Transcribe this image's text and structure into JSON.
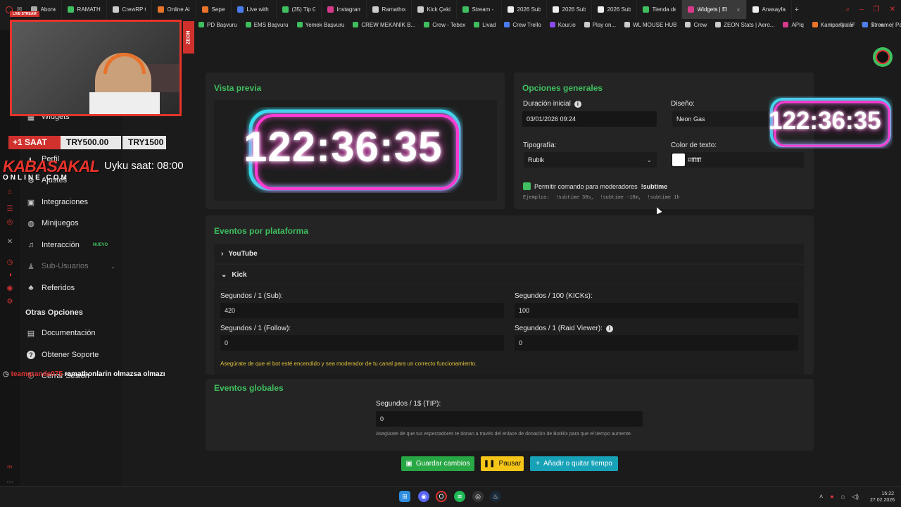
{
  "browser": {
    "tabs": [
      {
        "label": "Abonelikler",
        "color": "#aaaaaa"
      },
      {
        "label": "RAMATHON",
        "color": "#3fbf5f"
      },
      {
        "label": "CrewRP Ca",
        "color": "#cccccc"
      },
      {
        "label": "Online Alışv",
        "color": "#e8732a"
      },
      {
        "label": "Sepetim",
        "color": "#e8732a"
      },
      {
        "label": "Live with Ri",
        "color": "#4a7cf0"
      },
      {
        "label": "(35) Tip Go",
        "color": "#3fbf5f"
      },
      {
        "label": "Instagram",
        "color": "#d63a8a"
      },
      {
        "label": "Ramathon 2",
        "color": "#cccccc"
      },
      {
        "label": "Kick Çekiliş",
        "color": "#cccccc"
      },
      {
        "label": "Stream - Ki",
        "color": "#3fbf5f"
      },
      {
        "label": "2026 Subat",
        "color": "#eeeeee"
      },
      {
        "label": "2026 Subat",
        "color": "#eeeeee"
      },
      {
        "label": "2026 Subat",
        "color": "#eeeeee"
      },
      {
        "label": "Tienda de ...",
        "color": "#3fbf5f"
      },
      {
        "label": "Widgets | El mejor so",
        "color": "#d63a8a",
        "active": true
      },
      {
        "label": "Anasayfa / ...",
        "color": "#eeeeee"
      }
    ],
    "bookmarks": [
      {
        "label": "PD Başvuru",
        "color": "#3fbf5f"
      },
      {
        "label": "EMS Başvuru",
        "color": "#3fbf5f"
      },
      {
        "label": "Yemek Başvuru",
        "color": "#3fbf5f"
      },
      {
        "label": "CREW MEKANİK B...",
        "color": "#3fbf5f"
      },
      {
        "label": "Crew - Tebex",
        "color": "#3fbf5f"
      },
      {
        "label": "Livad",
        "color": "#3fbf5f"
      },
      {
        "label": "Crew Trello",
        "color": "#4a7cf0"
      },
      {
        "label": "Kour.io",
        "color": "#8a4af0"
      },
      {
        "label": "Play on...",
        "color": "#cccccc"
      },
      {
        "label": "WL MOUSE HUB",
        "color": "#cccccc"
      },
      {
        "label": "Crew",
        "color": "#cccccc"
      },
      {
        "label": "ZEON Stats | Aero...",
        "color": "#cccccc"
      },
      {
        "label": "APIq",
        "color": "#d63a8a"
      },
      {
        "label": "Kampanyalar",
        "color": "#e8732a"
      },
      {
        "label": "Streamer Panel",
        "color": "#4a7cf0"
      }
    ]
  },
  "sidebar": {
    "items": [
      {
        "label": "Widgets",
        "icon": "widgets-icon"
      },
      {
        "label": "Perfil",
        "icon": "user-icon"
      },
      {
        "label": "Ajustes",
        "icon": "settings-icon"
      },
      {
        "label": "Integraciones",
        "icon": "plug-icon"
      },
      {
        "label": "Minijuegos",
        "icon": "gamepad-icon"
      },
      {
        "label": "Interacción",
        "icon": "music-icon",
        "badge": "NUEVO"
      },
      {
        "label": "Sub-Usuarios",
        "icon": "users-icon"
      },
      {
        "label": "Referidos",
        "icon": "referrals-icon"
      }
    ],
    "section_title": "Otras Opciones",
    "other_items": [
      {
        "label": "Documentación",
        "icon": "doc-icon"
      },
      {
        "label": "Obtener Soporte",
        "icon": "help-icon"
      },
      {
        "label": "Cerrar Sesión",
        "icon": "logout-icon"
      }
    ]
  },
  "preview": {
    "title": "Vista previa",
    "time": "122:36:35"
  },
  "general": {
    "title": "Opciones generales",
    "duration_label": "Duración inicial",
    "duration_value": "03/01/2026 09:24",
    "design_label": "Diseño:",
    "design_value": "Neon Gas",
    "font_label": "Tipografía:",
    "font_value": "Rubik",
    "color_label": "Color de texto:",
    "color_value": "#ffffff",
    "mod_label": "Permitir comando para moderadores",
    "mod_command": "!subtime",
    "examples": "Ejemplos:  !subtime 30s,  !subtime -10m,  !subtime 1h"
  },
  "platform": {
    "title": "Eventos por plataforma",
    "youtube_label": "YouTube",
    "kick_label": "Kick",
    "sub_label": "Segundos / 1 (Sub):",
    "sub_value": "420",
    "kicks_label": "Segundos / 100 (KICKs):",
    "kicks_value": "100",
    "follow_label": "Segundos / 1 (Follow):",
    "follow_value": "0",
    "raid_label": "Segundos / 1 (Raid Viewer):",
    "raid_value": "0",
    "warning": "Asegúrate de que el bot esté encendido y sea moderador de tu canal para un correcto funcionamiento."
  },
  "global": {
    "title": "Eventos globales",
    "tip_label": "Segundos / 1$ (TIP):",
    "tip_value": "0",
    "tip_hint": "Asegúrate de que tus espectadores te donan a través del enlace de donación de BotRix para que el tiempo aumente."
  },
  "buttons": {
    "save": "Guardar cambios",
    "pause": "Pausar",
    "addtime": "Añadir o quitar tiempo"
  },
  "stream_overlay": {
    "live_badge": "LIVE STREAM",
    "zeon": "ZEON",
    "timer": "122:36:35",
    "donation_tag": "+1 SAAT",
    "donation_1": "TRY500.00",
    "donation_2": "TRY1500",
    "brand": "KABASAKAL",
    "brand_sub": "ONLINE.COM",
    "sleep": "Uyku saat: 08:00",
    "chat_user": "teamgrande075",
    "chat_text": "ramathonlarin olmazsa olmazı"
  },
  "system": {
    "time": "15:22",
    "date": "27.02.2026"
  },
  "colors": {
    "accent_green": "#3fbf5f",
    "neon_pink": "#ff3bd1",
    "neon_cyan": "#2ee6f0",
    "warning_yellow": "#e0c23a",
    "pause_yellow": "#f5c518",
    "add_teal": "#17a2b8"
  }
}
